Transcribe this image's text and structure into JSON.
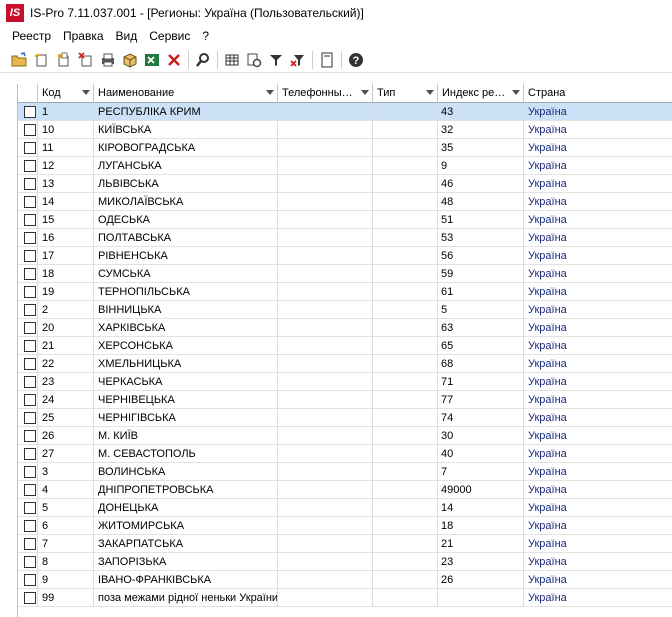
{
  "window": {
    "title": "IS-Pro 7.11.037.001 - [Регионы: Україна (Пользовательский)]",
    "logo_text": "IS"
  },
  "menu": [
    "Реестр",
    "Правка",
    "Вид",
    "Сервис",
    "?"
  ],
  "toolbar": [
    "open-folder-icon",
    "new-item-icon",
    "new-copy-icon",
    "delete-item-icon",
    "print-icon",
    "package-icon",
    "excel-icon",
    "close-x-icon",
    "search-icon",
    "table-icon",
    "settings-icon",
    "filter-icon",
    "clear-filter-icon",
    "document-icon",
    "help-icon"
  ],
  "columns": [
    {
      "label": "Код",
      "has_arrow": true
    },
    {
      "label": "Наименование",
      "has_arrow": true
    },
    {
      "label": "Телефонны…",
      "has_arrow": true
    },
    {
      "label": "Тип",
      "has_arrow": true
    },
    {
      "label": "Индекс ре…",
      "has_arrow": true
    },
    {
      "label": "Страна",
      "has_arrow": false
    }
  ],
  "rows": [
    {
      "code": "1",
      "name": "РЕСПУБЛІКА КРИМ",
      "phone": "",
      "type": "",
      "index": "43",
      "country": "Україна",
      "selected": true
    },
    {
      "code": "10",
      "name": "КИЇВСЬКА",
      "phone": "",
      "type": "",
      "index": "32",
      "country": "Україна"
    },
    {
      "code": "11",
      "name": "КІРОВОГРАДСЬКА",
      "phone": "",
      "type": "",
      "index": "35",
      "country": "Україна"
    },
    {
      "code": "12",
      "name": "ЛУГАНСЬКА",
      "phone": "",
      "type": "",
      "index": " 9",
      "country": "Україна"
    },
    {
      "code": "13",
      "name": "ЛЬВІВСЬКА",
      "phone": "",
      "type": "",
      "index": "46",
      "country": "Україна"
    },
    {
      "code": "14",
      "name": "МИКОЛАЇВСЬКА",
      "phone": "",
      "type": "",
      "index": "48",
      "country": "Україна"
    },
    {
      "code": "15",
      "name": "ОДЕСЬКА",
      "phone": "",
      "type": "",
      "index": "51",
      "country": "Україна"
    },
    {
      "code": "16",
      "name": "ПОЛТАВСЬКА",
      "phone": "",
      "type": "",
      "index": "53",
      "country": "Україна"
    },
    {
      "code": "17",
      "name": "РІВНЕНСЬКА",
      "phone": "",
      "type": "",
      "index": "56",
      "country": "Україна"
    },
    {
      "code": "18",
      "name": "СУМСЬКА",
      "phone": "",
      "type": "",
      "index": "59",
      "country": "Україна"
    },
    {
      "code": "19",
      "name": "ТЕРНОПІЛЬСЬКА",
      "phone": "",
      "type": "",
      "index": "61",
      "country": "Україна"
    },
    {
      "code": "2",
      "name": "ВІННИЦЬКА",
      "phone": "",
      "type": "",
      "index": " 5",
      "country": "Україна"
    },
    {
      "code": "20",
      "name": "ХАРКІВСЬКА",
      "phone": "",
      "type": "",
      "index": "63",
      "country": "Україна"
    },
    {
      "code": "21",
      "name": "ХЕРСОНСЬКА",
      "phone": "",
      "type": "",
      "index": "65",
      "country": "Україна"
    },
    {
      "code": "22",
      "name": "ХМЕЛЬНИЦЬКА",
      "phone": "",
      "type": "",
      "index": "68",
      "country": "Україна"
    },
    {
      "code": "23",
      "name": "ЧЕРКАСЬКА",
      "phone": "",
      "type": "",
      "index": "71",
      "country": "Україна"
    },
    {
      "code": "24",
      "name": "ЧЕРНІВЕЦЬКА",
      "phone": "",
      "type": "",
      "index": "77",
      "country": "Україна"
    },
    {
      "code": "25",
      "name": "ЧЕРНІГІВСЬКА",
      "phone": "",
      "type": "",
      "index": "74",
      "country": "Україна"
    },
    {
      "code": "26",
      "name": "М. КИЇВ",
      "phone": "",
      "type": "",
      "index": "30",
      "country": "Україна"
    },
    {
      "code": "27",
      "name": "М. СЕВАСТОПОЛЬ",
      "phone": "",
      "type": "",
      "index": "40",
      "country": "Україна"
    },
    {
      "code": "3",
      "name": "ВОЛИНСЬКА",
      "phone": "",
      "type": "",
      "index": " 7",
      "country": "Україна"
    },
    {
      "code": "4",
      "name": "ДНІПРОПЕТРОВСЬКА",
      "phone": "",
      "type": "",
      "index": "49000",
      "country": "Україна"
    },
    {
      "code": "5",
      "name": "ДОНЕЦЬКА",
      "phone": "",
      "type": "",
      "index": "14",
      "country": "Україна"
    },
    {
      "code": "6",
      "name": "ЖИТОМИРСЬКА",
      "phone": "",
      "type": "",
      "index": "18",
      "country": "Україна"
    },
    {
      "code": "7",
      "name": "ЗАКАРПАТСЬКА",
      "phone": "",
      "type": "",
      "index": "21",
      "country": "Україна"
    },
    {
      "code": "8",
      "name": "ЗАПОРІЗЬКА",
      "phone": "",
      "type": "",
      "index": "23",
      "country": "Україна"
    },
    {
      "code": "9",
      "name": "ІВАНО-ФРАНКІВСЬКА",
      "phone": "",
      "type": "",
      "index": "26",
      "country": "Україна"
    },
    {
      "code": "99",
      "name": "поза межами рідної неньки України",
      "phone": "",
      "type": "",
      "index": "",
      "country": "Україна"
    }
  ]
}
